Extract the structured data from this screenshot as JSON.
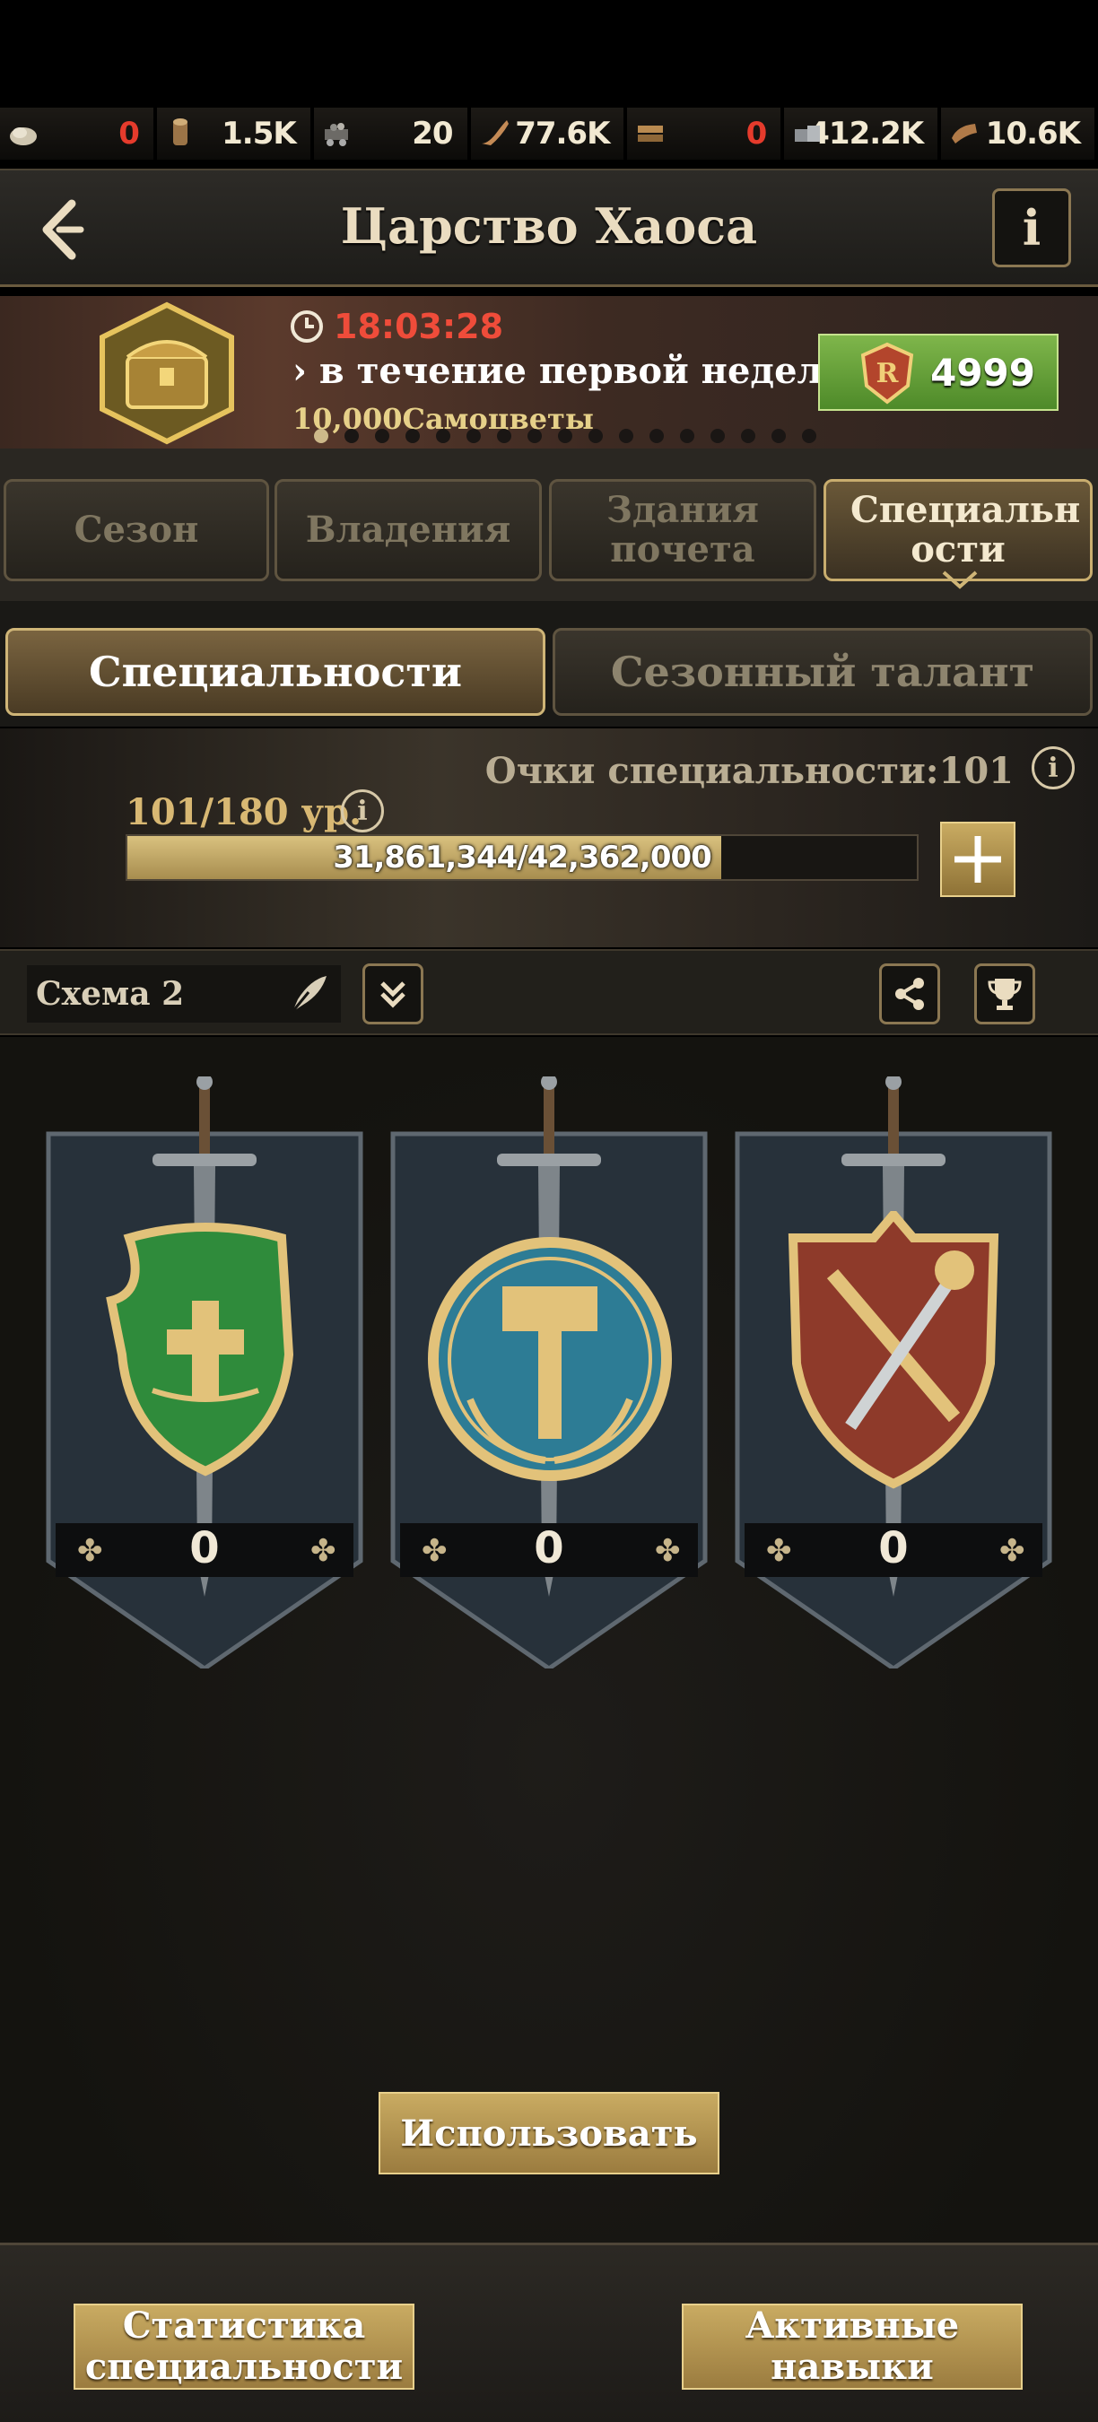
{
  "resources": [
    {
      "icon": "stone-icon",
      "value": "0",
      "color": "#e53b2c"
    },
    {
      "icon": "wood-icon",
      "value": "1.5K",
      "color": "#f2e9d2"
    },
    {
      "icon": "ore-cart-icon",
      "value": "20",
      "color": "#f2e9d2"
    },
    {
      "icon": "horn-icon",
      "value": "77.6K",
      "color": "#f2e9d2"
    },
    {
      "icon": "lumber-icon",
      "value": "0",
      "color": "#e53b2c"
    },
    {
      "icon": "iron-icon",
      "value": "412.2K",
      "color": "#f2e9d2"
    },
    {
      "icon": "leather-icon",
      "value": "10.6K",
      "color": "#f2e9d2"
    }
  ],
  "header": {
    "title": "Царство Хаоса"
  },
  "banner": {
    "timer": "18:03:28",
    "line": "› в течение первой недели",
    "subline": "10,000Самоцветы",
    "price": "4999",
    "dots_total": 17,
    "dots_active": 0
  },
  "tabs": [
    {
      "label": "Сезон",
      "active": false
    },
    {
      "label": "Владения",
      "active": false
    },
    {
      "label": "Здания почета",
      "active": false
    },
    {
      "label": "Специальн ости",
      "active": true
    }
  ],
  "subtabs": [
    {
      "label": "Специальности",
      "active": true
    },
    {
      "label": "Сезонный талант",
      "active": false
    }
  ],
  "specialty": {
    "points_label": "Очки специальности:101",
    "level_label": "101/180 ур.",
    "progress_text": "31,861,344/42,362,000",
    "progress_fraction": 0.752
  },
  "scheme": {
    "name": "Схема 2"
  },
  "cards": [
    {
      "icon": "green-shield-cross-icon",
      "count": "0"
    },
    {
      "icon": "blue-hammer-laurel-icon",
      "count": "0"
    },
    {
      "icon": "red-shield-crossed-weapons-icon",
      "count": "0"
    }
  ],
  "actions": {
    "use": "Использовать"
  },
  "footer": {
    "stats": "Статистика специальности",
    "skills": "Активные навыки"
  },
  "colors": {
    "gold": "#c9ab62",
    "green": "#6aa23a",
    "red": "#e53b2c",
    "dark_bg": "#14130f"
  }
}
